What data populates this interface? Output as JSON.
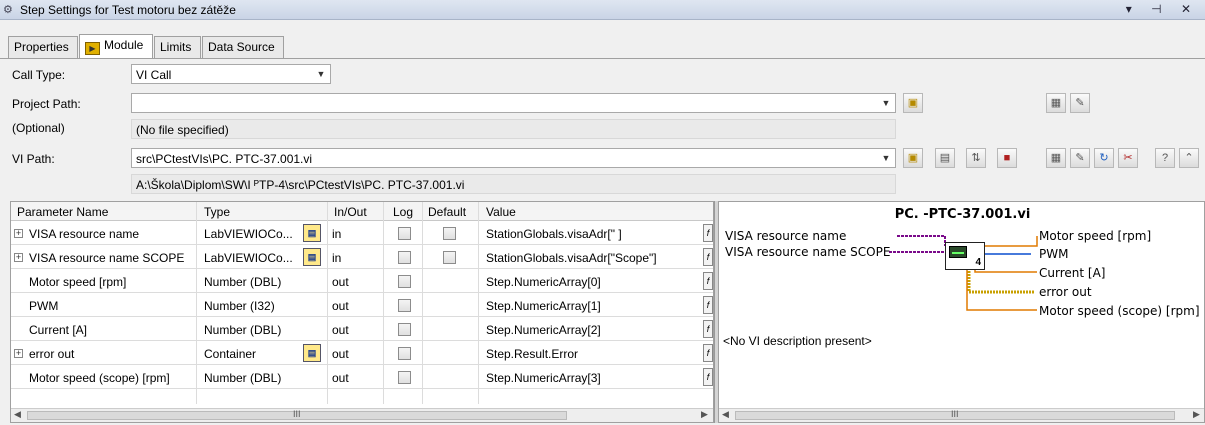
{
  "window": {
    "title": "Step Settings for Test motoru bez zátěže",
    "controls": "▾ ⊣ ✕"
  },
  "tabs": [
    {
      "label": "Properties",
      "active": false
    },
    {
      "label": "Module",
      "active": true
    },
    {
      "label": "Limits",
      "active": false
    },
    {
      "label": "Data Source",
      "active": false
    }
  ],
  "form": {
    "call_type_label": "Call Type:",
    "call_type_value": "VI Call",
    "project_path_label": "Project Path:",
    "project_path_value": "",
    "optional_label": "(Optional)",
    "no_file_text": "(No file specified)",
    "vi_path_label": "VI Path:",
    "vi_path_value": "src\\PCtestVIs\\PC.              PTC-37.001.vi",
    "vi_path_resolved": "A:\\Škola\\Diplom\\SW\\I                ᴾTP-4\\src\\PCtestVIs\\PC.              PTC-37.001.vi"
  },
  "grid": {
    "headers": [
      "Parameter Name",
      "Type",
      "In/Out",
      "Log",
      "Default",
      "Value"
    ],
    "rows": [
      {
        "name": "VISA resource name",
        "type": "LabVIEWIOCo...",
        "inout": "in",
        "value": "StationGlobals.visaAdr[\"              ]",
        "expand": true,
        "type_icon": true,
        "log": true,
        "default": true
      },
      {
        "name": "VISA resource name SCOPE",
        "type": "LabVIEWIOCo...",
        "inout": "in",
        "value": "StationGlobals.visaAdr[\"Scope\"]",
        "expand": true,
        "type_icon": true,
        "log": true,
        "default": true
      },
      {
        "name": "Motor speed               [rpm]",
        "type": "Number (DBL)",
        "inout": "out",
        "value": "Step.NumericArray[0]",
        "expand": false,
        "type_icon": false,
        "log": true,
        "default": false
      },
      {
        "name": "PWM",
        "type": "Number (I32)",
        "inout": "out",
        "value": "Step.NumericArray[1]",
        "expand": false,
        "type_icon": false,
        "log": true,
        "default": false
      },
      {
        "name": "Current [A]",
        "type": "Number (DBL)",
        "inout": "out",
        "value": "Step.NumericArray[2]",
        "expand": false,
        "type_icon": false,
        "log": true,
        "default": false
      },
      {
        "name": "error out",
        "type": "Container",
        "inout": "out",
        "value": "Step.Result.Error",
        "expand": true,
        "type_icon": true,
        "log": true,
        "default": false
      },
      {
        "name": "Motor speed (scope) [rpm]",
        "type": "Number (DBL)",
        "inout": "out",
        "value": "Step.NumericArray[3]",
        "expand": false,
        "type_icon": false,
        "log": true,
        "default": false
      }
    ],
    "scroll_grip": "III"
  },
  "context_help": {
    "vi_name": "PC.            -PTC-37.001.vi",
    "inputs": [
      "VISA resource name",
      "VISA resource name SCOPE"
    ],
    "outputs": [
      "Motor speed               [rpm]",
      "PWM",
      "Current [A]",
      "error out",
      "Motor speed (scope) [rpm]"
    ],
    "icon_number": "4",
    "description": "<No VI description present>",
    "scroll_grip": "III"
  },
  "colors": {
    "wire_visa": "#7a0a8a",
    "wire_number": "#e07a00",
    "wire_i32": "#0a4fcf",
    "wire_error": "#c8a000"
  }
}
